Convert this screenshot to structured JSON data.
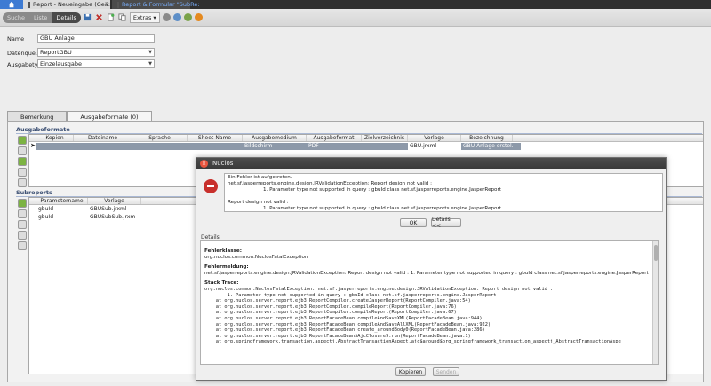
{
  "tabs": [
    {
      "label": "Report  - Neueingabe (Geä:"
    },
    {
      "label": "Report & Formular \"SubRe:"
    }
  ],
  "toolbar": {
    "seg": [
      "Suche",
      "Liste",
      "Details"
    ],
    "extras_label": "Extras"
  },
  "form": {
    "name_label": "Name",
    "name_value": "GBU Anlage",
    "datenquelle_label": "Datenque...",
    "datenquelle_value": "ReportGBU",
    "ausgabetyp_label": "Ausgabetyp",
    "ausgabetyp_value": "Einzelausgabe"
  },
  "subtabs": [
    "Bemerkung",
    "Ausgabeformate (0)"
  ],
  "ausgabeformate": {
    "title": "Ausgabeformate",
    "columns": [
      "Kopien",
      "Dateiname",
      "Sprache",
      "Sheet-Name",
      "Ausgabemedium",
      "Ausgabeformat",
      "Zielverzeichnis",
      "Vorlage",
      "Bezeichnung"
    ],
    "row": {
      "medium": "Bildschirm",
      "format": "PDF",
      "vorlage": "GBU.jrxml",
      "bezeichnung": "GBU Anlage erstel..."
    }
  },
  "subreports": {
    "title": "Subreports",
    "columns": [
      "Parametername",
      "Vorlage"
    ],
    "rows": [
      {
        "param": "gbuId",
        "vorlage": "GBUSub.jrxml"
      },
      {
        "param": "gbuId",
        "vorlage": "GBUSubSub.jrxm"
      }
    ]
  },
  "dialog": {
    "title": "Nuclos",
    "msg1": "Ein Fehler ist aufgetreten.",
    "msg2": "net.sf.jasperreports.engine.design.JRValidationException: Report design not valid :",
    "msg3": "1. Parameter type not supported in query : gbuId class net.sf.jasperreports.engine.JasperReport",
    "msg4": "Report design not valid :",
    "msg5": "1. Parameter type not supported in query : gbuId class net.sf.jasperreports.engine.JasperReport",
    "ok_label": "OK",
    "details_btn_label": "Details <<",
    "details_label": "Details",
    "fehlerklasse_label": "Fehlerklasse:",
    "fehlerklasse_value": "org.nuclos.common.NuclosFatalException",
    "fehlermeldung_label": "Fehlermeldung:",
    "fehlermeldung_value": "net.sf.jasperreports.engine.design.JRValidationException: Report design not valid : 1. Parameter type not supported in query : gbuId class net.sf.jasperreports.engine.JasperReport",
    "stacktrace_label": "Stack Trace:",
    "stacktrace": [
      "org.nuclos.common.NuclosFatalException: net.sf.jasperreports.engine.design.JRValidationException: Report design not valid :",
      "        1. Parameter type not supported in query : gbuId class net.sf.jasperreports.engine.JasperReport",
      "    at org.nuclos.server.report.ejb3.ReportCompiler.createJasperReport(ReportCompiler.java:54)",
      "    at org.nuclos.server.report.ejb3.ReportCompiler.compileReport(ReportCompiler.java:76)",
      "    at org.nuclos.server.report.ejb3.ReportCompiler.compileReport(ReportCompiler.java:67)",
      "    at org.nuclos.server.report.ejb3.ReportFacadeBean.compileAndSaveXML(ReportFacadeBean.java:944)",
      "    at org.nuclos.server.report.ejb3.ReportFacadeBean.compileAndSaveAllXML(ReportFacadeBean.java:922)",
      "    at org.nuclos.server.report.ejb3.ReportFacadeBean.create_aroundBody0(ReportFacadeBean.java:286)",
      "    at org.nuclos.server.report.ejb3.ReportFacadeBean$AjcClosure9.run(ReportFacadeBean.java:1)",
      "    at org.springframework.transaction.aspectj.AbstractTransactionAspect.ajc$around$org_springframework_transaction_aspectj_AbstractTransactionAspe"
    ],
    "kopieren_label": "Kopieren",
    "senden_label": "Senden"
  }
}
